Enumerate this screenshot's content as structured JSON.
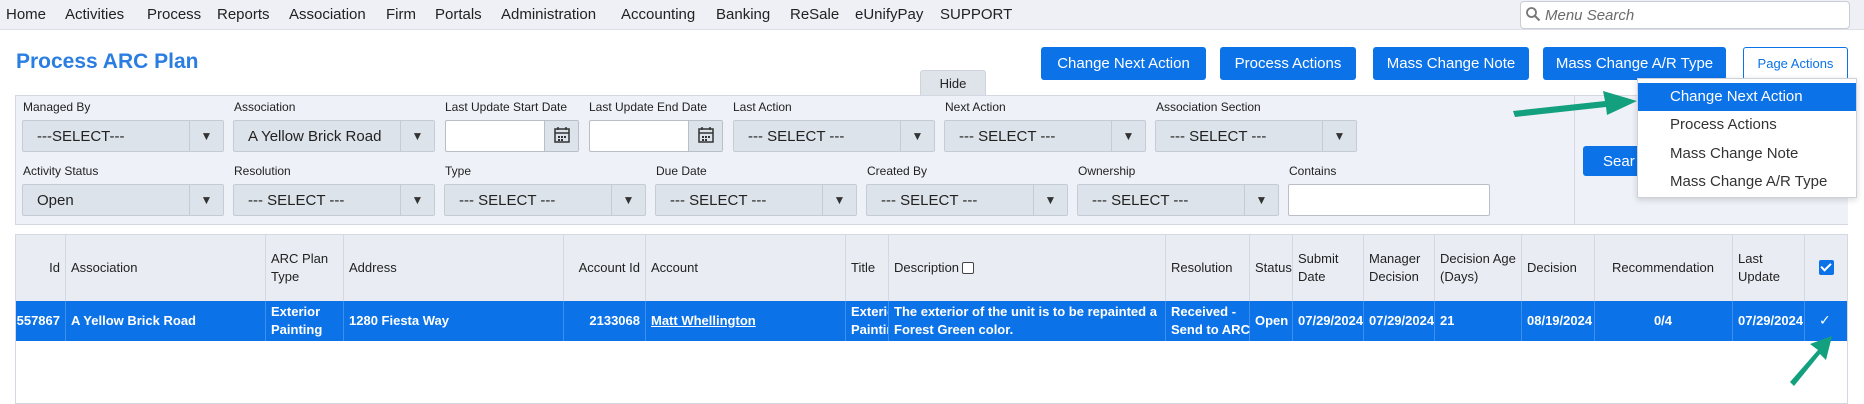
{
  "nav": {
    "items": [
      "Home",
      "Activities",
      "Process",
      "Reports",
      "Association",
      "Firm",
      "Portals",
      "Administration",
      "Accounting",
      "Banking",
      "ReSale",
      "eUnifyPay",
      "SUPPORT"
    ],
    "search_placeholder": "Menu Search"
  },
  "page": {
    "title": "Process ARC Plan"
  },
  "actions": {
    "change_next_action": "Change Next Action",
    "process_actions": "Process Actions",
    "mass_change_note": "Mass Change Note",
    "mass_change_ar_type": "Mass Change A/R Type",
    "page_actions": "Page Actions",
    "hide": "Hide"
  },
  "filters": {
    "managed_by": {
      "label": "Managed By",
      "value": "---SELECT---"
    },
    "association": {
      "label": "Association",
      "value": "A Yellow Brick Road"
    },
    "last_update_start": {
      "label": "Last Update Start Date",
      "value": ""
    },
    "last_update_end": {
      "label": "Last Update End Date",
      "value": ""
    },
    "last_action": {
      "label": "Last Action",
      "value": "--- SELECT ---"
    },
    "next_action": {
      "label": "Next Action",
      "value": "--- SELECT ---"
    },
    "association_section": {
      "label": "Association Section",
      "value": "--- SELECT ---"
    },
    "activity_status": {
      "label": "Activity Status",
      "value": "Open"
    },
    "resolution": {
      "label": "Resolution",
      "value": "--- SELECT ---"
    },
    "type": {
      "label": "Type",
      "value": "--- SELECT ---"
    },
    "due_date": {
      "label": "Due Date",
      "value": "--- SELECT ---"
    },
    "created_by": {
      "label": "Created By",
      "value": "--- SELECT ---"
    },
    "ownership": {
      "label": "Ownership",
      "value": "--- SELECT ---"
    },
    "contains": {
      "label": "Contains",
      "value": ""
    },
    "search_button": "Sear"
  },
  "table": {
    "headers": {
      "id": "Id",
      "association": "Association",
      "arc_plan_type": [
        "ARC Plan",
        "Type"
      ],
      "address": "Address",
      "account_id": "Account Id",
      "account": "Account",
      "title": "Title",
      "description": "Description",
      "resolution": "Resolution",
      "status": "Status",
      "submit_date": [
        "Submit",
        "Date"
      ],
      "manager_decision": [
        "Manager",
        "Decision"
      ],
      "decision_age": [
        "Decision Age",
        "(Days)"
      ],
      "decision": "Decision",
      "recommendation": "Recommendation",
      "last_update": [
        "Last",
        "Update"
      ]
    },
    "rows": [
      {
        "id": "557867",
        "association": "A Yellow Brick Road",
        "arc_plan_type": [
          "Exterior",
          "Painting"
        ],
        "address": "1280 Fiesta Way",
        "account_id": "2133068",
        "account": "Matt Whellington",
        "title": [
          "Exterior",
          "Painting"
        ],
        "description": [
          "The exterior of the unit is to be repainted a",
          "Forest Green color."
        ],
        "resolution": [
          "Received -",
          "Send to ARC"
        ],
        "status": "Open",
        "submit_date": "07/29/2024",
        "manager_decision": "07/29/2024",
        "decision_age": "21",
        "decision": "08/19/2024",
        "recommendation": "0/4",
        "last_update": "07/29/2024",
        "selected": true
      }
    ]
  },
  "dropdown": {
    "items": [
      "Change Next Action",
      "Process Actions",
      "Mass Change Note",
      "Mass Change A/R Type"
    ],
    "active_index": 0
  },
  "colors": {
    "primary": "#0b72e8",
    "title": "#2a7de1",
    "annotation_arrow": "#12a07e"
  }
}
